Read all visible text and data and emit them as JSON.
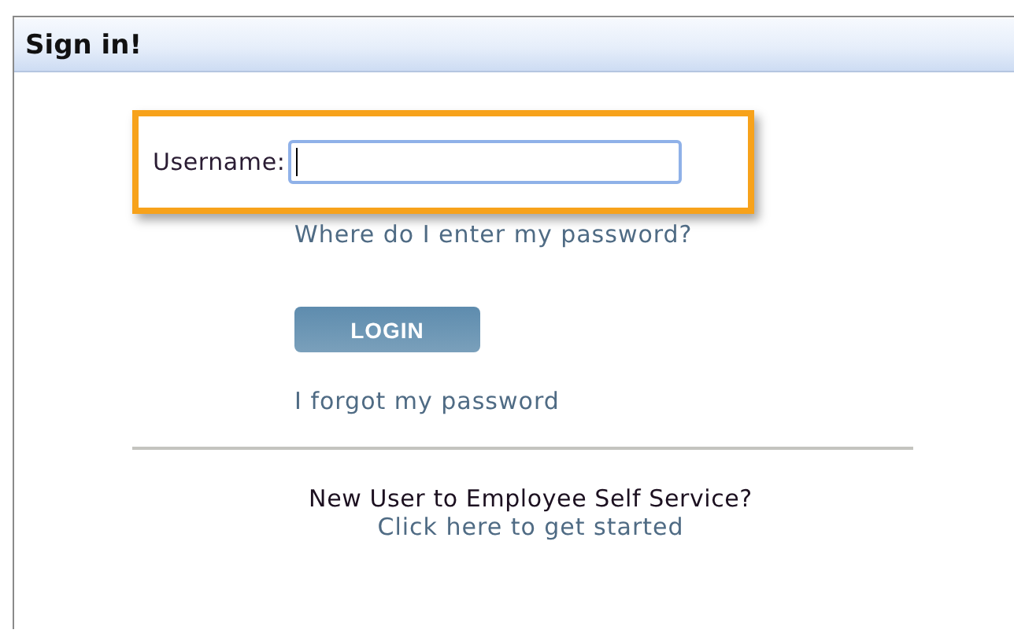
{
  "panel": {
    "title": "Sign in!"
  },
  "username": {
    "label": "Username:",
    "highlighted": true,
    "focused": true
  },
  "help_link": "Where do I enter my password?",
  "login_button": "LOGIN",
  "forgot_link": "I forgot my password",
  "new_user": {
    "prompt": "New User to Employee Self Service?",
    "link": "Click here to get started"
  }
}
